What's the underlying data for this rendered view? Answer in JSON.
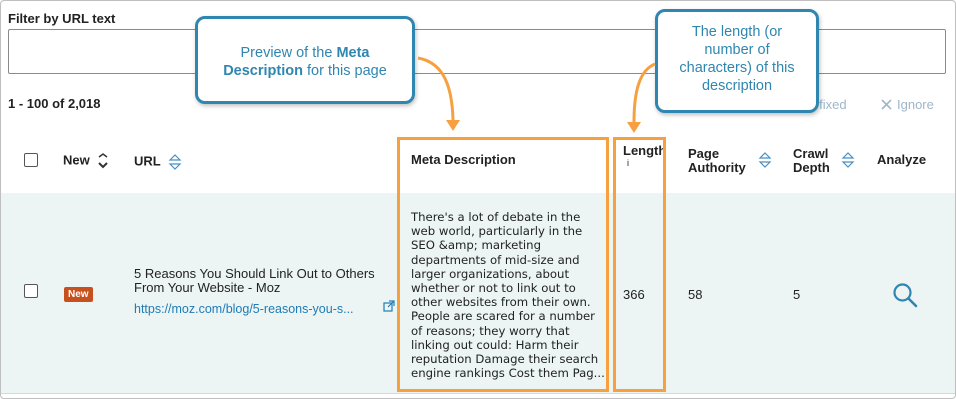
{
  "filter": {
    "label": "Filter by URL text",
    "value": ""
  },
  "results": {
    "count_text": "1 - 100 of 2,018"
  },
  "actions": {
    "mark_fixed": "s fixed",
    "ignore": "Ignore"
  },
  "columns": {
    "new": "New",
    "url": "URL",
    "meta_description": "Meta Description",
    "length": "Length",
    "length_info": "i",
    "page_authority": "Page Authority",
    "crawl_depth": "Crawl Depth",
    "analyze": "Analyze"
  },
  "rows": [
    {
      "badge": "New",
      "title": "5 Reasons You Should Link Out to Others From Your Website - Moz",
      "url": "https://moz.com/blog/5-reasons-you-s...",
      "meta_description": "There's a lot of debate in the web world, particularly in the SEO &amp; marketing departments of mid-size and larger organizations, about whether or not to link out to other websites from their own. People are scared for a number of reasons; they worry that linking out could: Harm their reputation Damage their search engine rankings Cost them Pag...",
      "length": "366",
      "page_authority": "58",
      "crawl_depth": "5"
    }
  ],
  "callouts": {
    "meta": {
      "pre": "Preview of the ",
      "bold1": "Meta",
      "bold2": "Description",
      "post": " for this page"
    },
    "length": "The length (or number of characters) of this description"
  },
  "colors": {
    "callout": "#2f86b0",
    "highlight": "#f7a040",
    "badge": "#c7501f",
    "link": "#1f7cb5",
    "row": "#ecf4f4"
  }
}
